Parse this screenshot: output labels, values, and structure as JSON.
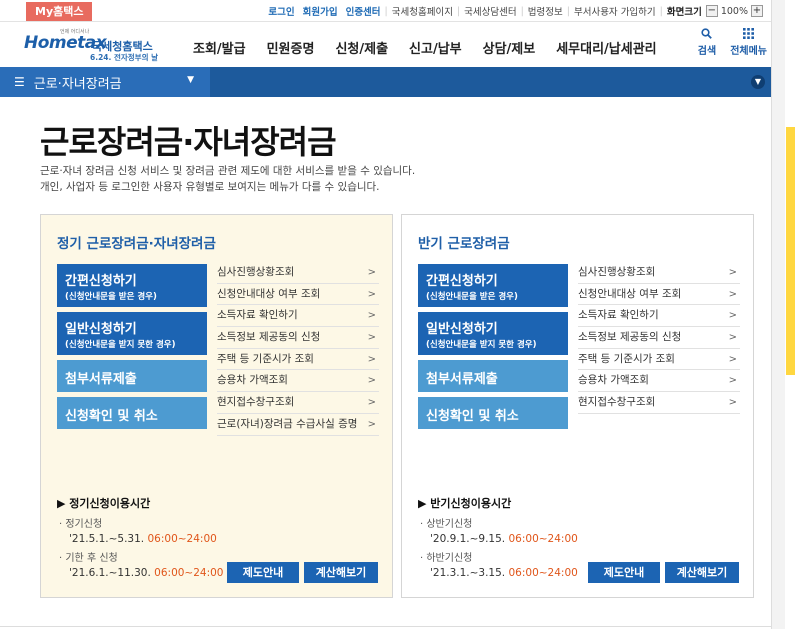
{
  "topbar": {
    "my_hometax": "My홈택스",
    "links": [
      {
        "label": "로그인",
        "emph": true
      },
      {
        "label": "회원가입",
        "emph": true
      },
      {
        "label": "인증센터",
        "emph": true
      },
      {
        "label": "국세청홈페이지",
        "emph": false
      },
      {
        "label": "국세상담센터",
        "emph": false
      },
      {
        "label": "법령정보",
        "emph": false
      },
      {
        "label": "부서사용자 가입하기",
        "emph": false
      }
    ],
    "font_size_label": "화면크기",
    "font_size_value": "100%",
    "minus": "−",
    "plus": "+"
  },
  "header": {
    "logo_text": "Hometax",
    "logo_tiny": "언제 어디서나",
    "logo_kname": "국세청홈택스",
    "logo_sub": "6.24. 전자정부의 날",
    "nav": [
      "조회/발급",
      "민원증명",
      "신청/제출",
      "신고/납부",
      "상담/제보",
      "세무대리/납세관리"
    ],
    "search_label": "검색",
    "menu_label": "전체메뉴"
  },
  "menubar": {
    "title": "근로·자녀장려금"
  },
  "page": {
    "title": "근로장려금·자녀장려금",
    "desc1": "근로·자녀 장려금 신청 서비스 및 장려금 관련 제도에 대한 서비스를 받을 수 있습니다.",
    "desc2": "개인, 사업자 등 로그인한 사용자 유형별로 보여지는 메뉴가 다를 수 있습니다."
  },
  "left_card": {
    "title": "정기 근로장려금·자녀장려금",
    "buttons": [
      {
        "title": "간편신청하기",
        "sub": "(신청안내문을 받은 경우)"
      },
      {
        "title": "일반신청하기",
        "sub": "(신청안내문을 받지 못한 경우)"
      },
      {
        "title": "첨부서류제출",
        "sub": ""
      },
      {
        "title": "신청확인 및 취소",
        "sub": ""
      }
    ],
    "links": [
      "심사진행상황조회",
      "신청안내대상 여부 조회",
      "소득자료 확인하기",
      "소득정보 제공동의 신청",
      "주택 등 기준시가 조회",
      "승용차 가액조회",
      "현지접수창구조회",
      "근로(자녀)장려금 수급사실 증명"
    ],
    "use_heading": "정기신청이용시간",
    "periods": [
      {
        "label": "정기신청",
        "dates": "'21.5.1.~5.31.",
        "time": "06:00~24:00"
      },
      {
        "label": "기한 후 신청",
        "dates": "'21.6.1.~11.30.",
        "time": "06:00~24:00"
      }
    ],
    "btn_guide": "제도안내",
    "btn_calc": "계산해보기"
  },
  "right_card": {
    "title": "반기 근로장려금",
    "buttons": [
      {
        "title": "간편신청하기",
        "sub": "(신청안내문을 받은 경우)"
      },
      {
        "title": "일반신청하기",
        "sub": "(신청안내문을 받지 못한 경우)"
      },
      {
        "title": "첨부서류제출",
        "sub": ""
      },
      {
        "title": "신청확인 및 취소",
        "sub": ""
      }
    ],
    "links": [
      "심사진행상황조회",
      "신청안내대상 여부 조회",
      "소득자료 확인하기",
      "소득정보 제공동의 신청",
      "주택 등 기준시가 조회",
      "승용차 가액조회",
      "현지접수창구조회"
    ],
    "use_heading": "반기신청이용시간",
    "periods": [
      {
        "label": "상반기신청",
        "dates": "'20.9.1.~9.15.",
        "time": "06:00~24:00"
      },
      {
        "label": "하반기신청",
        "dates": "'21.3.1.~3.15.",
        "time": "06:00~24:00"
      }
    ],
    "btn_guide": "제도안내",
    "btn_calc": "계산해보기"
  },
  "colors": {
    "brand_blue": "#1c64b3",
    "light_blue": "#4d9bd1",
    "menubar": "#1d5a9c",
    "time_orange": "#e0561b",
    "left_card_bg": "#fdf8e6",
    "side_panel": "#ffd740"
  }
}
